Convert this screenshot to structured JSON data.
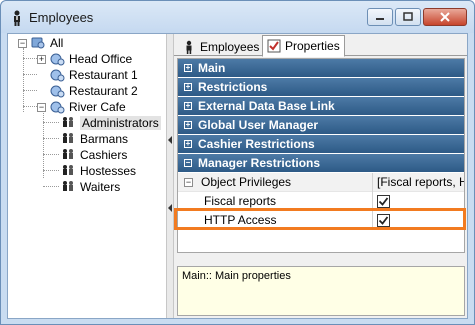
{
  "window": {
    "title": "Employees"
  },
  "tree": {
    "root": "All",
    "items": [
      {
        "label": "Head Office"
      },
      {
        "label": "Restaurant 1"
      },
      {
        "label": "Restaurant 2"
      },
      {
        "label": "River Cafe"
      },
      {
        "label": "Administrators"
      },
      {
        "label": "Barmans"
      },
      {
        "label": "Cashiers"
      },
      {
        "label": "Hostesses"
      },
      {
        "label": "Waiters"
      }
    ]
  },
  "tabs": [
    {
      "label": "Employees"
    },
    {
      "label": "Properties"
    }
  ],
  "grid": {
    "categories": [
      {
        "label": "Main",
        "sign": "+"
      },
      {
        "label": "Restrictions",
        "sign": "+"
      },
      {
        "label": "External Data Base Link",
        "sign": "+"
      },
      {
        "label": "Global User Manager",
        "sign": "+"
      },
      {
        "label": "Cashier Restrictions",
        "sign": "+"
      },
      {
        "label": "Manager Restrictions",
        "sign": "−"
      }
    ],
    "object_privileges": {
      "label": "Object Privileges",
      "value": "[Fiscal reports, HTTP Access]",
      "sign": "−"
    },
    "fiscal_reports": {
      "label": "Fiscal reports",
      "checked": true
    },
    "http_access": {
      "label": "HTTP Access",
      "checked": true
    }
  },
  "description": "Main:: Main properties",
  "colors": {
    "highlight": "#f27b20",
    "category_bg": "#3a6793"
  }
}
